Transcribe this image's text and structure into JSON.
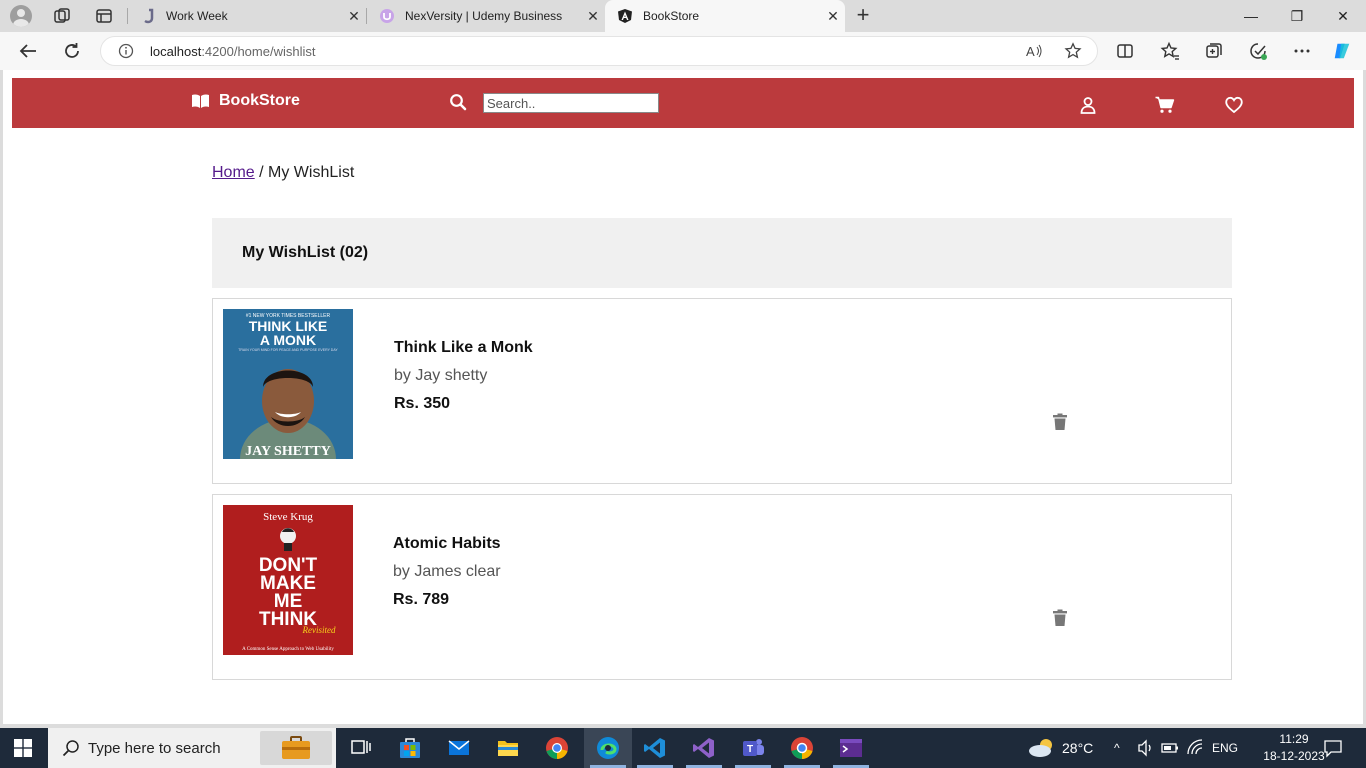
{
  "browser": {
    "tabs": [
      {
        "title": "Work Week",
        "icon": "teams-j-icon"
      },
      {
        "title": "NexVersity | Udemy Business",
        "icon": "udemy-icon"
      },
      {
        "title": "BookStore",
        "icon": "angular-icon",
        "active": true
      }
    ],
    "url_host": "localhost",
    "url_path": ":4200/home/wishlist"
  },
  "header": {
    "brand": "BookStore",
    "search_placeholder": "Search..",
    "accent_color": "#bb3a3d"
  },
  "breadcrumb": {
    "home": "Home",
    "separator": " / ",
    "current": "My WishList"
  },
  "wishlist": {
    "title": "My WishList (02)",
    "items": [
      {
        "title": "Think Like a Monk",
        "author": "by Jay shetty",
        "price": "Rs. 350",
        "cover": {
          "tagline": "#1 NEW YORK TIMES BESTSELLER",
          "title_line1": "THINK LIKE",
          "title_line2": "A MONK",
          "subtitle": "TRAIN YOUR MIND FOR PEACE AND PURPOSE EVERY DAY",
          "author": "JAY SHETTY"
        }
      },
      {
        "title": "Atomic Habits",
        "author": "by James clear",
        "price": "Rs. 789",
        "cover": {
          "author": "Steve Krug",
          "title_line1": "DON'T",
          "title_line2": "MAKE",
          "title_line3": "ME",
          "title_line4": "THINK",
          "revisited": "Revisited",
          "subtitle": "A Common Sense Approach to Web Usability"
        }
      }
    ]
  },
  "taskbar": {
    "search_placeholder": "Type here to search",
    "weather": "28°C",
    "language": "ENG",
    "time": "11:29",
    "date": "18-12-2023"
  }
}
